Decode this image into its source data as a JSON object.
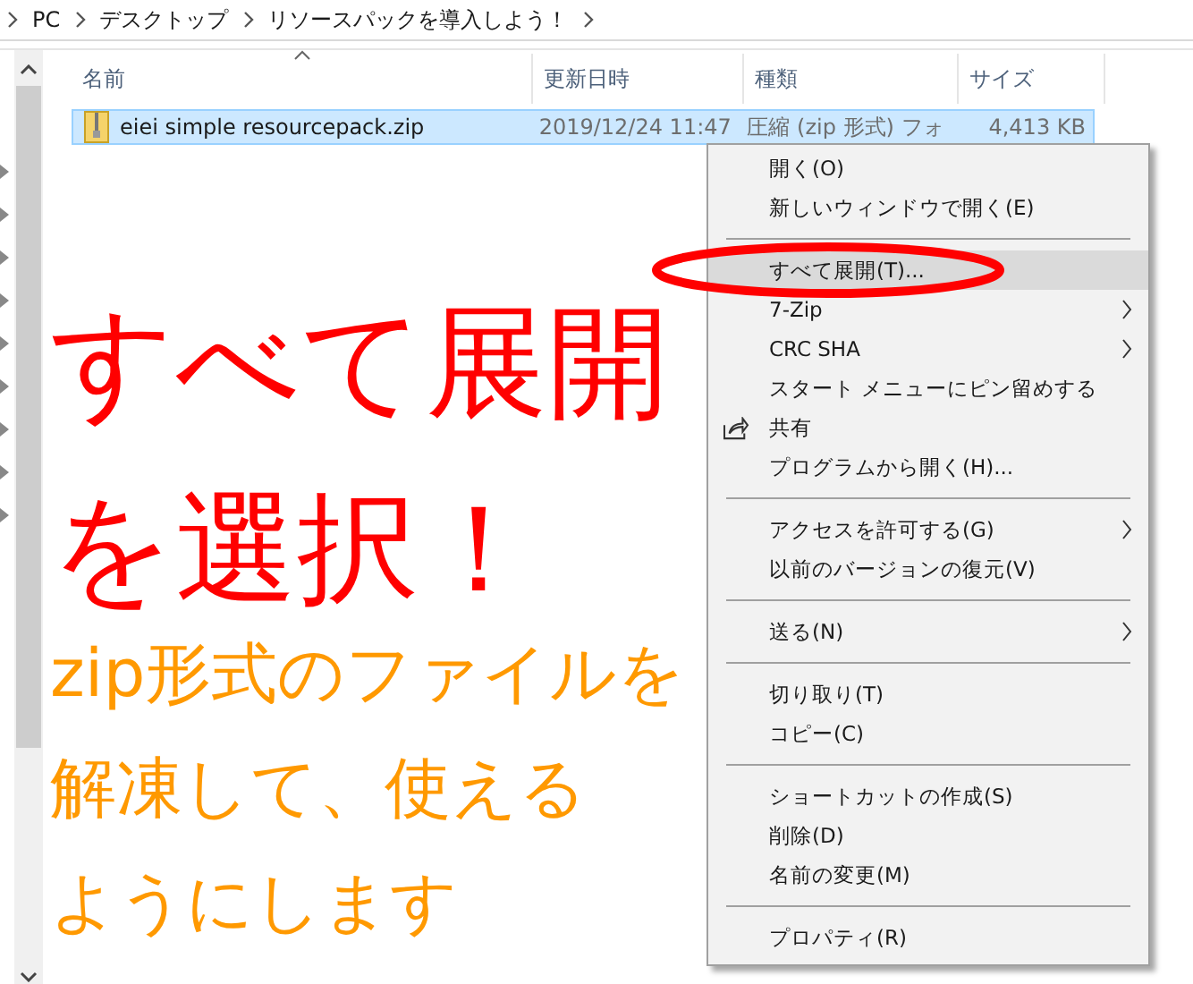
{
  "breadcrumb": [
    "PC",
    "デスクトップ",
    "リソースパックを導入しよう！"
  ],
  "columns": [
    {
      "label": "名前",
      "sorted": true
    },
    {
      "label": "更新日時",
      "sorted": false
    },
    {
      "label": "種類",
      "sorted": false
    },
    {
      "label": "サイズ",
      "sorted": false
    }
  ],
  "files": [
    {
      "name": "eiei simple resourcepack.zip",
      "date": "2019/12/24 11:47",
      "type": "圧縮 (zip 形式) フォ",
      "size": "4,413 KB",
      "selected": true
    }
  ],
  "context_menu": {
    "items": [
      {
        "kind": "item",
        "label": "開く(O)",
        "selected": false,
        "submenu": false
      },
      {
        "kind": "item",
        "label": "新しいウィンドウで開く(E)",
        "selected": false,
        "submenu": false
      },
      {
        "kind": "separator"
      },
      {
        "kind": "item",
        "label": "すべて展開(T)...",
        "selected": true,
        "submenu": false
      },
      {
        "kind": "item",
        "label": "7-Zip",
        "selected": false,
        "submenu": true
      },
      {
        "kind": "item",
        "label": "CRC SHA",
        "selected": false,
        "submenu": true
      },
      {
        "kind": "item",
        "label": "スタート メニューにピン留めする",
        "selected": false,
        "submenu": false
      },
      {
        "kind": "share",
        "label": "共有",
        "selected": false,
        "submenu": false
      },
      {
        "kind": "item",
        "label": "プログラムから開く(H)...",
        "selected": false,
        "submenu": false
      },
      {
        "kind": "separator"
      },
      {
        "kind": "item",
        "label": "アクセスを許可する(G)",
        "selected": false,
        "submenu": true
      },
      {
        "kind": "item",
        "label": "以前のバージョンの復元(V)",
        "selected": false,
        "submenu": false
      },
      {
        "kind": "separator"
      },
      {
        "kind": "item",
        "label": "送る(N)",
        "selected": false,
        "submenu": true
      },
      {
        "kind": "separator"
      },
      {
        "kind": "item",
        "label": "切り取り(T)",
        "selected": false,
        "submenu": false
      },
      {
        "kind": "item",
        "label": "コピー(C)",
        "selected": false,
        "submenu": false
      },
      {
        "kind": "separator"
      },
      {
        "kind": "item",
        "label": "ショートカットの作成(S)",
        "selected": false,
        "submenu": false
      },
      {
        "kind": "item",
        "label": "削除(D)",
        "selected": false,
        "submenu": false
      },
      {
        "kind": "item",
        "label": "名前の変更(M)",
        "selected": false,
        "submenu": false
      },
      {
        "kind": "separator"
      },
      {
        "kind": "item",
        "label": "プロパティ(R)",
        "selected": false,
        "submenu": false
      }
    ]
  },
  "annotation": {
    "callout": [
      "すべて展開",
      "を選択！"
    ],
    "note": [
      "zip形式のファイルを",
      "解凍して、使える",
      "ようにします"
    ]
  }
}
